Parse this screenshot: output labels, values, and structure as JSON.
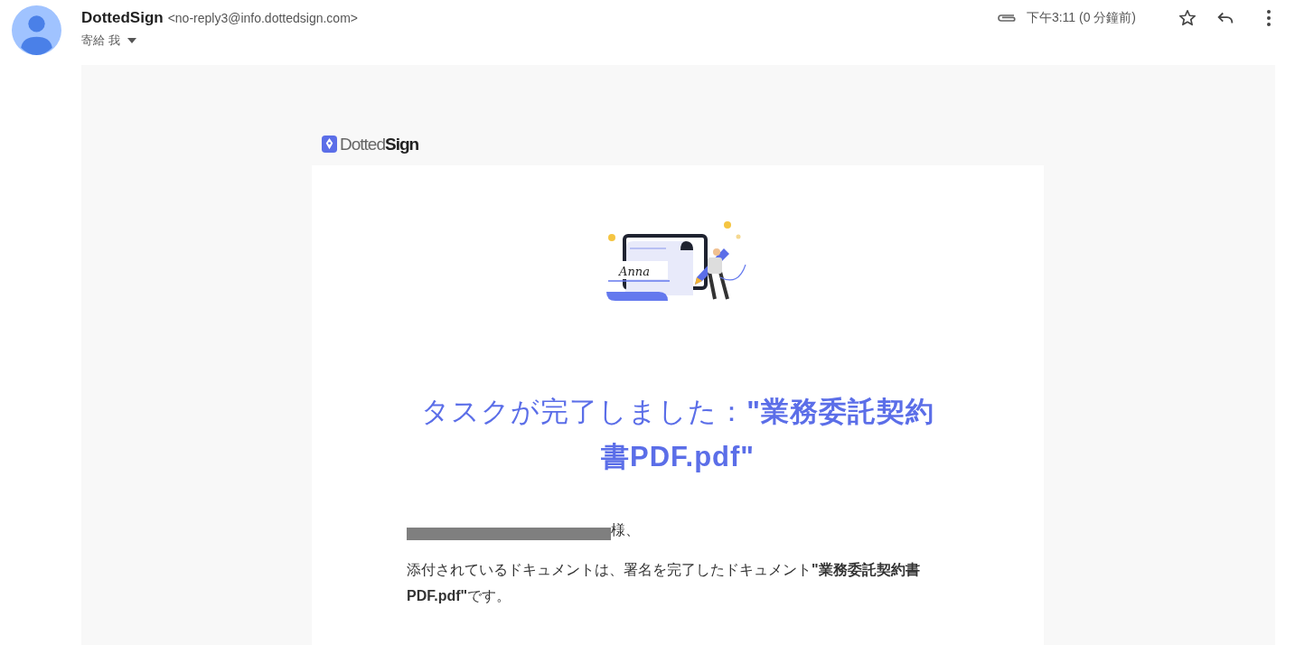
{
  "sender": {
    "name": "DottedSign",
    "address": "<no-reply3@info.dottedsign.com>",
    "recipient": "寄給 我",
    "has_attachment": true,
    "time": "下午3:11 (0 分鐘前)",
    "starred": false
  },
  "email": {
    "logo": "Dotted**Sign**",
    "illustration_signature": "Anna",
    "title": "タスクが完了しました：**\"業務委託契約書PDF.pdf\"**",
    "greeting": {
      "redacted": true,
      "suffix": "様、"
    },
    "body": "添付されているドキュメントは、署名を完了したドキュメント**\"業務委託契約書PDF.pdf\"**です。"
  }
}
